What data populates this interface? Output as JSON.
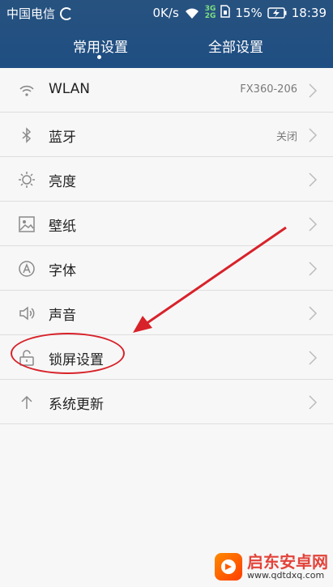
{
  "status_bar": {
    "carrier": "中国电信",
    "speed": "0K/s",
    "network_badge_top": "3G",
    "network_badge_bottom": "2G",
    "battery_percent": "15%",
    "time": "18:39"
  },
  "tabs": [
    {
      "label": "常用设置",
      "active": true
    },
    {
      "label": "全部设置",
      "active": false
    }
  ],
  "settings": [
    {
      "label": "WLAN",
      "value": "FX360-206",
      "icon": "wifi-icon"
    },
    {
      "label": "蓝牙",
      "value": "关闭",
      "icon": "bluetooth-icon"
    },
    {
      "label": "亮度",
      "value": "",
      "icon": "brightness-icon"
    },
    {
      "label": "壁纸",
      "value": "",
      "icon": "wallpaper-icon"
    },
    {
      "label": "字体",
      "value": "",
      "icon": "font-icon"
    },
    {
      "label": "声音",
      "value": "",
      "icon": "speaker-icon"
    },
    {
      "label": "锁屏设置",
      "value": "",
      "icon": "unlock-icon"
    },
    {
      "label": "系统更新",
      "value": "",
      "icon": "arrow-up-icon"
    }
  ],
  "watermark": {
    "name": "启东安卓网",
    "url": "www.qdtdxq.com"
  },
  "colors": {
    "header_bg": "#1f4e83",
    "annotation_red": "#d8222a"
  }
}
